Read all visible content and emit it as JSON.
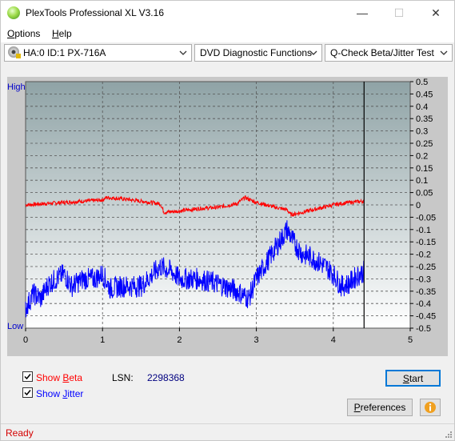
{
  "window": {
    "title": "PlexTools Professional XL V3.16",
    "controls": {
      "minimize": "—",
      "maximize": "☐",
      "close": "✕"
    }
  },
  "menu": {
    "options": "Options",
    "options_mnemonic": "O",
    "options_rest": "ptions",
    "help": "Help",
    "help_mnemonic": "H",
    "help_rest": "elp"
  },
  "toolbar": {
    "drive": "HA:0 ID:1  PX-716A",
    "function": "DVD Diagnostic Functions",
    "test": "Q-Check Beta/Jitter Test"
  },
  "chart_labels": {
    "high": "High",
    "low": "Low"
  },
  "chart_data": {
    "type": "line",
    "xlabel": "",
    "ylabel": "",
    "xlim": [
      0,
      5
    ],
    "x_ticks": [
      "0",
      "1",
      "2",
      "3",
      "4",
      "5"
    ],
    "ylim": [
      -0.5,
      0.5
    ],
    "y_ticks": [
      "0.5",
      "0.45",
      "0.4",
      "0.35",
      "0.3",
      "0.25",
      "0.2",
      "0.15",
      "0.1",
      "0.05",
      "0",
      "-0.05",
      "-0.1",
      "-0.15",
      "-0.2",
      "-0.25",
      "-0.3",
      "-0.35",
      "-0.4",
      "-0.45",
      "-0.5"
    ],
    "grid": true,
    "cursor_x": 4.4,
    "series": [
      {
        "key": "beta",
        "color": "#ff0000",
        "x": [
          0,
          0.25,
          0.5,
          0.75,
          1.0,
          1.05,
          1.25,
          1.5,
          1.75,
          1.8,
          2.0,
          2.25,
          2.5,
          2.75,
          2.85,
          3.0,
          3.25,
          3.4,
          3.45,
          3.6,
          3.8,
          4.0,
          4.2,
          4.4
        ],
        "values": [
          0.0,
          0.005,
          0.01,
          0.015,
          0.02,
          0.03,
          0.025,
          0.015,
          0.005,
          -0.03,
          -0.025,
          -0.015,
          -0.01,
          0.005,
          0.03,
          0.01,
          -0.01,
          -0.02,
          -0.04,
          -0.03,
          -0.015,
          0.0,
          0.01,
          0.015
        ]
      },
      {
        "key": "jitter",
        "color": "#0000ff",
        "x": [
          0,
          0.1,
          0.2,
          0.3,
          0.4,
          0.5,
          0.6,
          0.75,
          0.9,
          1.0,
          1.1,
          1.25,
          1.5,
          1.75,
          1.9,
          2.0,
          2.25,
          2.5,
          2.75,
          2.9,
          3.0,
          3.1,
          3.2,
          3.3,
          3.4,
          3.5,
          3.6,
          3.7,
          3.8,
          3.9,
          4.0,
          4.1,
          4.2,
          4.3,
          4.4
        ],
        "values": [
          -0.42,
          -0.36,
          -0.38,
          -0.32,
          -0.3,
          -0.28,
          -0.33,
          -0.3,
          -0.3,
          -0.28,
          -0.34,
          -0.33,
          -0.33,
          -0.25,
          -0.27,
          -0.3,
          -0.3,
          -0.32,
          -0.35,
          -0.38,
          -0.3,
          -0.25,
          -0.2,
          -0.15,
          -0.1,
          -0.16,
          -0.2,
          -0.21,
          -0.23,
          -0.25,
          -0.28,
          -0.33,
          -0.32,
          -0.29,
          -0.27
        ]
      }
    ]
  },
  "controls": {
    "show_beta": "Show Beta",
    "show_beta_pre": "Show ",
    "show_beta_mnemonic": "B",
    "show_beta_rest": "eta",
    "show_beta_checked": true,
    "show_jitter": "Show Jitter",
    "show_jitter_pre": "Show ",
    "show_jitter_mnemonic": "J",
    "show_jitter_rest": "itter",
    "show_jitter_checked": true,
    "lsn_label": "LSN:",
    "lsn_value": "2298368",
    "start_button": "Start",
    "start_mnemonic": "S",
    "start_rest": "tart",
    "preferences_button": "Preferences",
    "preferences_mnemonic": "P",
    "preferences_rest": "references",
    "info_icon": "info-icon"
  },
  "colors": {
    "beta": "#ff0000",
    "jitter": "#0000ff",
    "axis_label_high_low": "#0000cc",
    "status": "#d40000",
    "plot_top": "#8fa3a6",
    "plot_bottom": "#ffffff"
  },
  "status": {
    "text": "Ready"
  }
}
